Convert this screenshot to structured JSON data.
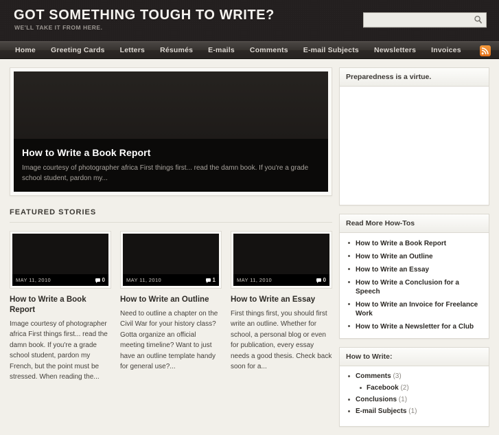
{
  "header": {
    "title": "GOT SOMETHING TOUGH TO WRITE?",
    "tagline": "WE'LL TAKE IT FROM HERE.",
    "search": {
      "value": "",
      "placeholder": "",
      "icon": "search-icon"
    }
  },
  "nav": {
    "items": [
      {
        "label": "Home"
      },
      {
        "label": "Greeting Cards"
      },
      {
        "label": "Letters"
      },
      {
        "label": "Résumés"
      },
      {
        "label": "E-mails"
      },
      {
        "label": "Comments"
      },
      {
        "label": "E-mail Subjects"
      },
      {
        "label": "Newsletters"
      },
      {
        "label": "Invoices"
      }
    ],
    "rss_icon": "rss-icon",
    "rss_color": "#e8801f"
  },
  "hero": {
    "title": "How to Write a Book Report",
    "excerpt": "Image courtesy of photographer africa First things first... read the damn book. If you're a grade school student, pardon my..."
  },
  "featured": {
    "heading": "FEATURED STORIES",
    "cards": [
      {
        "date": "MAY 11, 2010",
        "comments": "0",
        "title": "How to Write a Book Report",
        "excerpt": "Image courtesy of photographer africa First things first... read the damn book. If you're a grade school student, pardon my French, but the point must be stressed. When reading the..."
      },
      {
        "date": "MAY 11, 2010",
        "comments": "1",
        "title": "How to Write an Outline",
        "excerpt": "Need to outline a chapter on the Civil War for your history class? Gotta organize an official meeting timeline? Want to just have an outline template handy for general use?..."
      },
      {
        "date": "MAY 11, 2010",
        "comments": "0",
        "title": "How to Write an Essay",
        "excerpt": "First things first, you should first write an outline. Whether for school, a personal blog or even for publication, every essay needs a good thesis. Check back soon for a..."
      }
    ]
  },
  "sidebar": {
    "widgets": [
      {
        "heading": "Preparedness is a virtue."
      },
      {
        "heading": "Read More How-Tos"
      },
      {
        "heading": "How to Write:"
      }
    ],
    "how_tos": [
      {
        "label": "How to Write a Book Report"
      },
      {
        "label": "How to Write an Outline"
      },
      {
        "label": "How to Write an Essay"
      },
      {
        "label": "How to Write a Conclusion for a Speech"
      },
      {
        "label": "How to Write an Invoice for Freelance Work"
      },
      {
        "label": "How to Write a Newsletter for a Club"
      }
    ],
    "categories": [
      {
        "name": "Comments",
        "count": "(3)",
        "children": [
          {
            "name": "Facebook",
            "count": "(2)"
          }
        ]
      },
      {
        "name": "Conclusions",
        "count": "(1)",
        "children": []
      },
      {
        "name": "E-mail Subjects",
        "count": "(1)",
        "children": []
      }
    ]
  }
}
